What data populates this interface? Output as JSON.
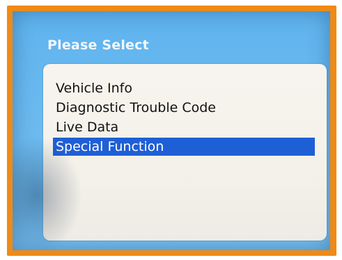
{
  "screen": {
    "title": "Please Select"
  },
  "menu": {
    "items": [
      {
        "label": "Vehicle Info",
        "selected": false
      },
      {
        "label": "Diagnostic Trouble Code",
        "selected": false
      },
      {
        "label": "Live Data",
        "selected": false
      },
      {
        "label": "Special Function",
        "selected": true
      }
    ]
  },
  "colors": {
    "frame": "#ef8a17",
    "screen_bg": "#6ab9ef",
    "panel_bg": "#f4f1ea",
    "highlight": "#1f5fd6",
    "title_text": "#f2f6fb"
  }
}
